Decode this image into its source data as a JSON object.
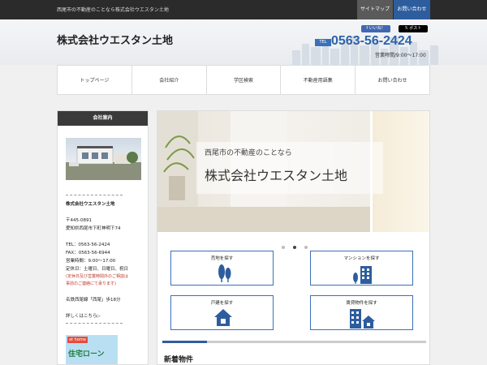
{
  "topbar": {
    "tagline": "西尾市の不動産のことなら株式会社ウエスタン土地",
    "sitemap": "サイトマップ",
    "contact": "お問い合わせ"
  },
  "header": {
    "title": "株式会社ウエスタン土地",
    "like": "いいね！",
    "post": "ポスト",
    "tel_label": "TEL",
    "tel_number": "0563-56-2424",
    "hours": "営業時間/9:00〜17:00"
  },
  "nav": [
    {
      "label": "トップページ"
    },
    {
      "label": "会社紹介"
    },
    {
      "label": "学区検索"
    },
    {
      "label": "不動産用語集"
    },
    {
      "label": "お問い合わせ"
    }
  ],
  "sidebar": {
    "heading": "会社案内",
    "company": "株式会社ウエスタン土地",
    "zip": "〒445-0891",
    "address": "愛知県西尾市下町神明下74",
    "tel": "TEL：0563-56-2424",
    "fax": "FAX：0563-56-6944",
    "hours": "営業時間：9:00～17:00",
    "holiday": "定休日：土曜日、日曜日、祝日",
    "note1": "(定休日及び営業時間外のご相談は",
    "note2": "事前のご連絡にて承ります)",
    "station": "名鉄西尾線「西尾」歩18分",
    "details_link": "詳しくはこちら▷",
    "banner_logo": "at home",
    "banner_text": "住宅ローン"
  },
  "slider": {
    "line1": "西尾市の不動産のことなら",
    "line2": "株式会社ウエスタン土地",
    "total_dots": 3,
    "active_dot": 2
  },
  "categories": [
    {
      "label": "売地を探す",
      "icon": "tree-icon"
    },
    {
      "label": "マンションを探す",
      "icon": "building-icon"
    },
    {
      "label": "戸建を探す",
      "icon": "house-icon"
    },
    {
      "label": "賃貸物件を探す",
      "icon": "apartment-icon"
    }
  ],
  "main": {
    "progress": 0.17,
    "news_title": "新着物件"
  },
  "colors": {
    "accent": "#2e5d9e",
    "topbar": "#2b2b2b",
    "sidebar_head": "#3a3a3a",
    "note_red": "#c0392b"
  }
}
